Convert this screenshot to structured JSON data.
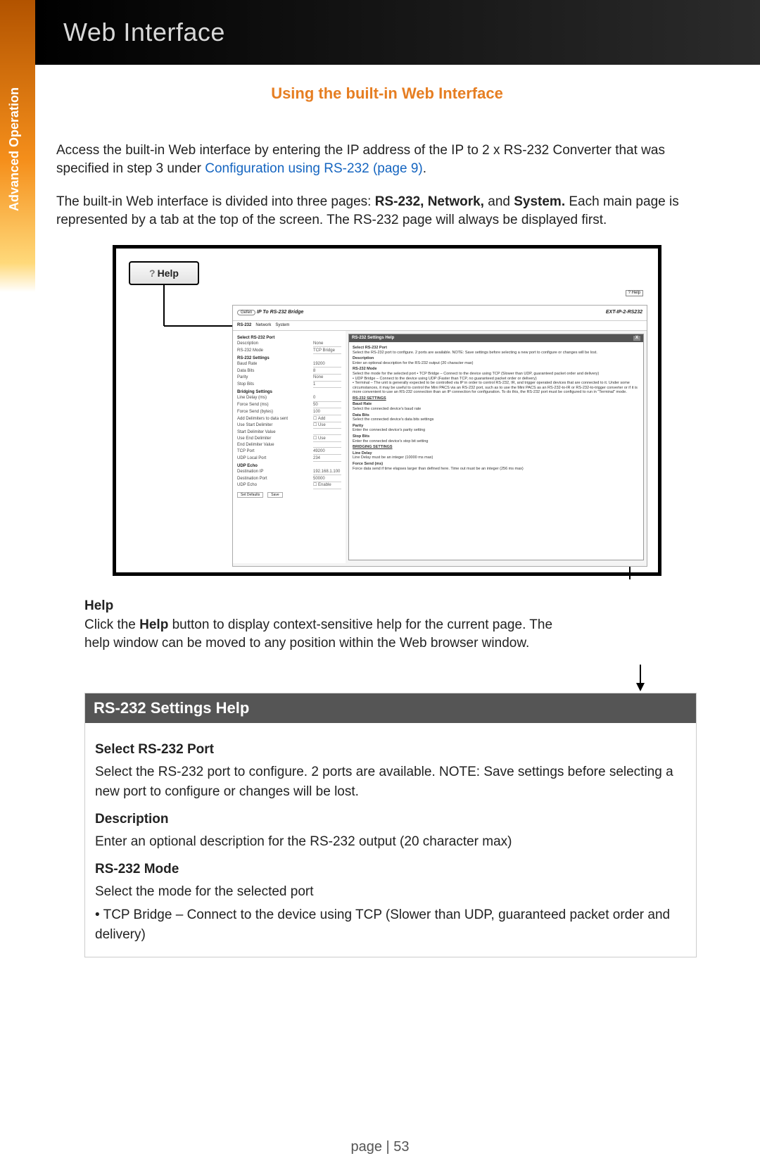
{
  "sidebar_label": "Advanced Operation",
  "header_title": "Web Interface",
  "section_title": "Using the built-in Web Interface",
  "intro1a": "Access the built-in Web interface by entering the IP address of the IP to 2 x RS-232 Converter that was specified in step 3 under ",
  "intro1_link": "Configuration using RS-232 (page 9)",
  "intro1b": ".",
  "intro2a": "The built-in Web interface is divided into three pages:  ",
  "intro2_bold": "RS-232, Network,",
  "intro2_mid": " and ",
  "intro2_bold2": "System.",
  "intro2b": "  Each main page is represented by a tab at the top of the screen.  The RS-232 page will always be displayed first.",
  "help_button": "Help",
  "help_q": "?",
  "mini": {
    "brand": "Gefen",
    "title": "IP To RS-232 Bridge",
    "model": "EXT-IP-2-RS232",
    "tabs": [
      "RS-232",
      "Network",
      "System"
    ],
    "minihelp": "? Help",
    "form_title": "Select RS-232 Port",
    "rows": [
      {
        "l": "Description",
        "v": "None"
      },
      {
        "l": "RS-232 Mode",
        "v": "TCP Bridge"
      }
    ],
    "sec1": "RS-232 Settings",
    "rows2": [
      {
        "l": "Baud Rate",
        "v": "19200"
      },
      {
        "l": "Data Bits",
        "v": "8"
      },
      {
        "l": "Parity",
        "v": "None"
      },
      {
        "l": "Stop Bits",
        "v": "1"
      }
    ],
    "sec2": "Bridging Settings",
    "rows3": [
      {
        "l": "Line Delay (ms)",
        "v": "0"
      },
      {
        "l": "Force Send (ms)",
        "v": "50"
      },
      {
        "l": "Force Send (bytes)",
        "v": "100"
      },
      {
        "l": "Add Delimiters to data sent",
        "v": "☐ Add"
      },
      {
        "l": "Use Start Delimiter",
        "v": "☐ Use"
      },
      {
        "l": "Start Delimiter Value",
        "v": ""
      },
      {
        "l": "Use End Delimiter",
        "v": "☐ Use"
      },
      {
        "l": "End Delimiter Value",
        "v": ""
      },
      {
        "l": "TCP Port",
        "v": "49200"
      },
      {
        "l": "UDP Local Port",
        "v": "234"
      }
    ],
    "sec3": "UDP Echo",
    "rows4": [
      {
        "l": "Destination IP",
        "v": "192.168.1.100"
      },
      {
        "l": "Destination Port",
        "v": "50000"
      },
      {
        "l": "UDP Echo",
        "v": "☐ Enable"
      }
    ],
    "btn1": "Set Defaults",
    "btn2": "Save",
    "hp_title": "RS-232 Settings Help",
    "hp_close": "X",
    "hp": {
      "h1": "Select RS-232 Port",
      "t1": "Select the RS-232 port to configure. 2 ports are available. NOTE: Save settings before selecting a new port to configure or changes will be lost.",
      "h2": "Description",
      "t2": "Enter an optional description for the RS-232 output (20 character max)",
      "h3": "RS-232 Mode",
      "t3": "Select the mode for the selected port",
      "t3a": "• TCP Bridge – Connect to the device using TCP (Slower than UDP, guaranteed packet order and delivery)",
      "t3b": "• UDP Bridge – Connect to the device using UDP (Faster than TCP, no guaranteed packet order or delivery)",
      "t3c": "• Terminal – The unit is generally expected to be controlled via IP in order to control RS-232, IR, and trigger operated devices that are connected to it. Under some circumstances, it may be useful to control the Mini PACS via an RS-232 port, such as to use the Mini PACS as an RS-232-to-IR or RS-232-to-trigger converter or if it is more convenient to use an RS-232 connection than an IP connection for configuration. To do this, the RS-232 port must be configured to run in \"Terminal\" mode.",
      "s1": "RS-232 SETTINGS",
      "h4": "Baud Rate",
      "t4": "Select the connected device's baud rate",
      "h5": "Data Bits",
      "t5": "Select the connected device's data bits settings",
      "h6": "Parity",
      "t6": "Enter the connected device's parity setting",
      "h7": "Stop Bits",
      "t7": "Enter the connected device's stop bit setting",
      "s2": "BRIDGING SETTINGS",
      "h8": "Line Delay",
      "t8": "Line Delay must be an integer (10000 ms max)",
      "h9": "Force Send (ms)",
      "t9": "Force data send if time elapses larger than defined here. Time out must be an integer (256 ms max)"
    }
  },
  "help_caption_title": "Help",
  "help_caption_a": "Click the ",
  "help_caption_bold": "Help",
  "help_caption_b": " button to display context-sensitive help for the current page.  The help window can be moved to any position within the Web browser window.",
  "zoom": {
    "title": "RS-232 Settings Help",
    "h1": "Select RS-232 Port",
    "p1": "Select the RS-232 port to configure. 2 ports are available. NOTE: Save settings before selecting a new port to configure or changes will be lost.",
    "h2": "Description",
    "p2": "Enter an optional description for the RS-232 output (20 character max)",
    "h3": "RS-232 Mode",
    "p3": "Select the mode for the selected port",
    "p4": "• TCP Bridge – Connect to the device using TCP (Slower than UDP, guaranteed packet order and delivery)"
  },
  "page_label": "page | 53"
}
